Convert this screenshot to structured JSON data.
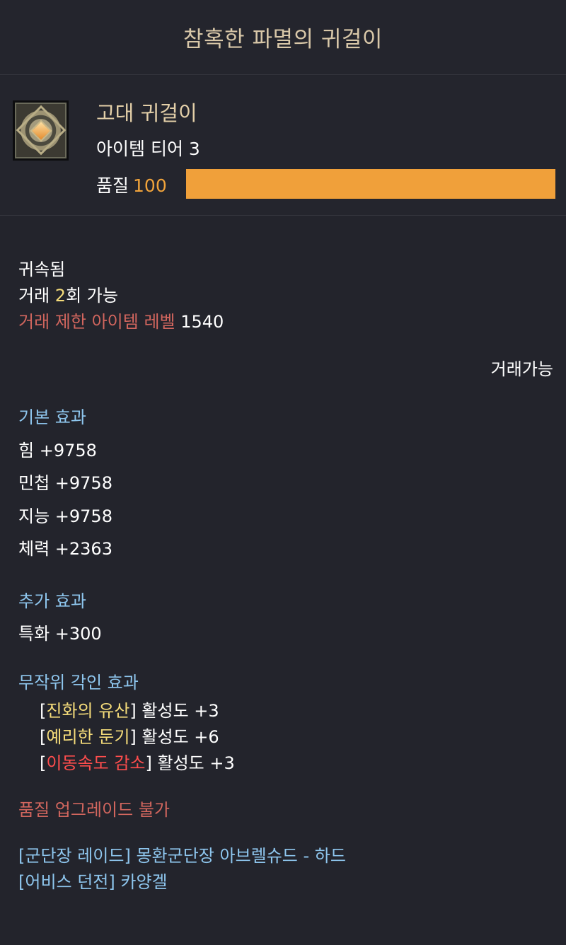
{
  "window": {
    "title": "참혹한 파멸의 귀걸이"
  },
  "item": {
    "grade": "고대 귀걸이",
    "tier": "아이템 티어 3",
    "quality_label": "품질",
    "quality_value": "100",
    "quality_fraction": 1.0,
    "icon": "earring-icon"
  },
  "trade": {
    "bound": "귀속됨",
    "trade_prefix": "거래 ",
    "trade_count": "2",
    "trade_suffix": "회 가능",
    "level_limit_label": "거래 제한 아이템 레벨",
    "level_limit_value": "1540",
    "tradable": "거래가능"
  },
  "base_effect": {
    "heading": "기본 효과",
    "stats": [
      "힘 +9758",
      "민첩 +9758",
      "지능 +9758",
      "체력 +2363"
    ]
  },
  "extra_effect": {
    "heading": "추가 효과",
    "stats": [
      "특화 +300"
    ]
  },
  "engraving_effect": {
    "heading": "무작위 각인 효과",
    "items": [
      {
        "name": "진화의 유산",
        "value": "활성도 +3",
        "color": "#f5dc7a"
      },
      {
        "name": "예리한 둔기",
        "value": "활성도 +6",
        "color": "#f5dc7a"
      },
      {
        "name": "이동속도 감소",
        "value": "활성도 +3",
        "color": "#ff4d4d"
      }
    ]
  },
  "upgrade": {
    "notice": "품질 업그레이드 불가"
  },
  "sources": [
    "[군단장 레이드] 몽환군단장 아브렐슈드 - 하드",
    "[어비스 던전] 카양겔"
  ],
  "colors": {
    "background": "#23242c",
    "title": "#d8c7a8",
    "grade": "#e3cfa8",
    "quality": "#f0a03a",
    "heading": "#8ec6ee",
    "restriction": "#d2665e"
  }
}
